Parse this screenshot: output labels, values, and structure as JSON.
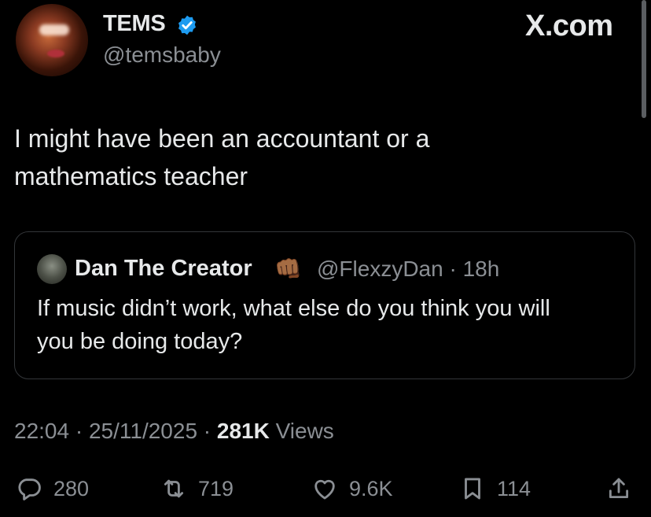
{
  "author": {
    "name": "TEMS",
    "handle": "@temsbaby",
    "verified": true
  },
  "brand": "X.com",
  "tweet": {
    "line1": "I might have been an accountant or a",
    "line2": "mathematics teacher"
  },
  "quote": {
    "name": "Dan The Creator",
    "emoji": "👊🏾",
    "handle": "@FlexzyDan · 18h",
    "line1": "If music didn’t work, what else do you think you will",
    "line2": "you be doing today?"
  },
  "meta": {
    "time": "22:04 · 25/11/2025 · ",
    "views_count": "281K",
    "views_label": " Views"
  },
  "actions": {
    "replies": "280",
    "reposts": "719",
    "likes": "9.6K",
    "bookmarks": "114"
  },
  "icons": [
    "verified-icon",
    "reply-icon",
    "repost-icon",
    "like-icon",
    "bookmark-icon",
    "share-icon"
  ],
  "colors": {
    "background": "#000000",
    "text": "#e7e9ea",
    "muted": "#8b8f94",
    "verified": "#1d9bf0",
    "border": "#333639"
  }
}
